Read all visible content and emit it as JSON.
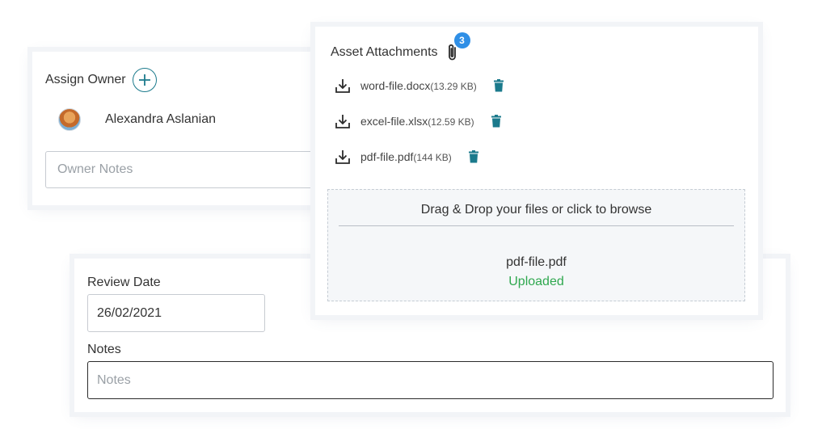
{
  "owner": {
    "title": "Assign Owner",
    "name": "Alexandra Aslanian",
    "notes_placeholder": "Owner Notes"
  },
  "review": {
    "date_label": "Review Date",
    "date_value": "26/02/2021",
    "notes_label": "Notes",
    "notes_placeholder": "Notes"
  },
  "attachments": {
    "title": "Asset Attachments",
    "count": "3",
    "files": [
      {
        "name": "word-file.docx",
        "size": "(13.29 KB)"
      },
      {
        "name": "excel-file.xlsx",
        "size": "(12.59 KB)"
      },
      {
        "name": "pdf-file.pdf",
        "size": "(144 KB)"
      }
    ],
    "dropzone_text": "Drag & Drop your files or click to browse",
    "uploaded_file": "pdf-file.pdf",
    "uploaded_status": "Uploaded"
  },
  "colors": {
    "accent": "#1b7a8c",
    "badge": "#2f8fe6",
    "success": "#2fa84f"
  }
}
